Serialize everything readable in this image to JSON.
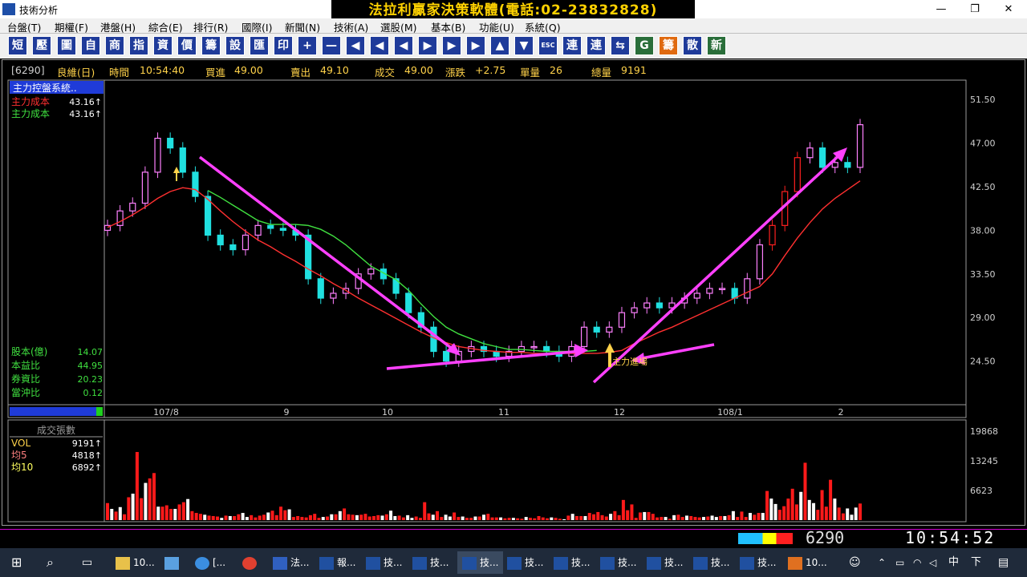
{
  "window": {
    "title": "技術分析",
    "banner": "法拉利贏家決策軟體(電話:02-23832828)",
    "controls": {
      "minimize": "—",
      "maximize": "❐",
      "close": "✕"
    }
  },
  "menu": [
    "台盤(T)",
    "期權(F)",
    "港盤(H)",
    "綜合(E)",
    "排行(R)",
    "國際(I)",
    "新聞(N)",
    "技術(A)",
    "選股(M)",
    "基本(B)",
    "功能(U)",
    "系統(Q)"
  ],
  "toolbar": [
    "短",
    "壓",
    "圖",
    "自",
    "商",
    "指",
    "資",
    "價",
    "籌",
    "設",
    "匯",
    "印",
    "+",
    "—",
    "◀",
    "◀",
    "◀",
    "▶",
    "▶",
    "▶",
    "▲",
    "▼",
    "ESC",
    "連",
    "連",
    "⇆",
    "G",
    "籌",
    "散",
    "新"
  ],
  "info": {
    "code": "[6290]",
    "name": "良維(日)",
    "time_label": "時間",
    "time_value": "10:54:40",
    "bid_label": "買進",
    "bid_value": "49.00",
    "ask_label": "賣出",
    "ask_value": "49.10",
    "deal_label": "成交",
    "deal_value": "49.00",
    "change_label": "漲跌",
    "change_value": "+2.75",
    "vol_label": "單量",
    "vol_value": "26",
    "total_label": "總量",
    "total_value": "9191"
  },
  "indicator": {
    "header": "主力控盤系統..",
    "lines": [
      {
        "label": "主力成本",
        "value": "43.16↑",
        "color": "#ff3030"
      },
      {
        "label": "主力成本",
        "value": "43.16↑",
        "color": "#40e040"
      }
    ]
  },
  "fundamentals": [
    {
      "label": "股本(億)",
      "value": "14.07"
    },
    {
      "label": "本益比",
      "value": "44.95"
    },
    {
      "label": "券資比",
      "value": "20.23"
    },
    {
      "label": "當沖比",
      "value": "0.12"
    }
  ],
  "volume_panel": {
    "header": "成交張數",
    "lines": [
      {
        "label": "VOL",
        "value": "9191↑",
        "color": "#ffd24a"
      },
      {
        "label": "均5",
        "value": "4818↑",
        "color": "#ff8080"
      },
      {
        "label": "均10",
        "value": "6892↑",
        "color": "#ffff60"
      }
    ]
  },
  "annotation": "主力進場",
  "status": {
    "code": "6290",
    "clock": "10:54:52"
  },
  "taskbar": [
    "10...",
    "[...",
    "法...",
    "報...",
    "技...",
    "技...",
    "技...",
    "技...",
    "技...",
    "技...",
    "技...",
    "技...",
    "技...",
    "10..."
  ],
  "tray": {
    "ime": "中",
    "clock": "下"
  },
  "chart_data": [
    {
      "type": "candlestick",
      "title": "",
      "x_ticks": [
        "107/8",
        "9",
        "10",
        "11",
        "12",
        "108/1",
        "2"
      ],
      "ylim": [
        20.0,
        53.5
      ],
      "y_ticks": [
        "51.50",
        "47.00",
        "42.50",
        "38.00",
        "33.50",
        "29.00",
        "24.50"
      ],
      "grid": false,
      "series": [
        {
          "name": "主力成本",
          "color": "#ff3030",
          "type": "line",
          "values": [
            38.3,
            38.9,
            39.6,
            40.4,
            41.3,
            42.0,
            42.4,
            42.2,
            41.2,
            40.0,
            38.9,
            37.9,
            37.0,
            36.3,
            35.5,
            34.8,
            34.0,
            33.3,
            32.5,
            31.8,
            31.0,
            30.3,
            29.6,
            28.9,
            28.2,
            27.5,
            26.9,
            26.4,
            26.0,
            25.8,
            25.6,
            25.5,
            25.4,
            25.4,
            25.3,
            25.3,
            25.3,
            25.3,
            25.3,
            25.3,
            25.4,
            25.6,
            26.3,
            26.9,
            27.5,
            28.0,
            28.6,
            29.2,
            29.8,
            30.4,
            31.0,
            31.6,
            32.2,
            33.5,
            35.4,
            37.2,
            38.8,
            40.2,
            41.3,
            42.2,
            43.1
          ]
        },
        {
          "name": "主力成本",
          "color": "#40e040",
          "type": "line",
          "values": [
            null,
            null,
            null,
            null,
            null,
            null,
            null,
            null,
            42.1,
            41.4,
            40.6,
            39.8,
            39.0,
            38.6,
            38.6,
            38.6,
            38.5,
            38.1,
            37.4,
            36.5,
            35.4,
            34.3,
            33.6,
            32.9,
            31.8,
            30.4,
            29.1,
            28.0,
            27.3,
            26.8,
            26.3,
            26.0,
            25.7,
            25.7,
            25.6,
            25.5,
            25.5,
            25.5,
            25.5,
            25.6,
            null,
            null,
            null,
            null,
            null,
            null,
            null,
            null,
            null,
            null,
            null,
            null,
            null,
            null,
            null,
            null,
            null,
            null,
            null,
            null,
            null
          ]
        }
      ],
      "candles_close": [
        38.5,
        40.0,
        40.8,
        44.0,
        47.5,
        46.5,
        44.0,
        41.5,
        37.5,
        36.5,
        36.0,
        37.5,
        38.5,
        38.2,
        38.0,
        37.5,
        33.0,
        31.0,
        31.5,
        32.0,
        33.5,
        34.0,
        33.0,
        31.5,
        29.5,
        28.0,
        25.5,
        24.5,
        25.5,
        26.0,
        25.5,
        25.0,
        25.5,
        26.0,
        26.0,
        25.5,
        25.0,
        26.0,
        28.0,
        27.5,
        28.0,
        29.5,
        30.0,
        30.5,
        30.0,
        30.5,
        31.0,
        31.5,
        32.0,
        32.0,
        31.0,
        33.0,
        36.5,
        38.5,
        42.0,
        45.5,
        46.5,
        44.5,
        45.0,
        44.5,
        48.9
      ],
      "volumes": [
        3800,
        2500,
        1900,
        2900,
        1300,
        5100,
        5900,
        15200,
        4900,
        8300,
        9300,
        10500,
        3000,
        3000,
        3300,
        2500,
        2500,
        3500,
        4000,
        4700,
        2000,
        1600,
        1400,
        1200,
        1000,
        900,
        800,
        500,
        1000,
        900,
        900,
        1300,
        1600,
        700,
        1100,
        600,
        1000,
        1200,
        1700,
        2100,
        1100,
        3000,
        2200,
        2400,
        700,
        900,
        700,
        600,
        1100,
        1400,
        500,
        700,
        800,
        1300,
        1300,
        2000,
        2600,
        1300,
        1200,
        1100,
        1200,
        1400,
        800,
        900,
        1100,
        1000,
        1300,
        2100,
        900,
        1000,
        600,
        1100,
        500,
        800,
        500,
        4000,
        1500,
        1200,
        2000,
        700,
        1200,
        800,
        1700,
        700,
        800,
        500,
        500,
        800,
        800,
        1200,
        1400,
        600,
        600,
        600,
        400,
        500,
        500,
        400,
        300,
        700,
        500,
        400,
        900,
        600,
        400,
        600,
        500,
        300,
        200,
        1000,
        1400,
        900,
        900,
        900,
        1600,
        1300,
        1800,
        1100,
        800,
        1400,
        2000,
        1100,
        4500,
        2200,
        3500,
        500,
        1700,
        1800,
        1800,
        1400,
        600,
        700,
        700,
        300,
        1100,
        1200,
        700,
        1000,
        900,
        700,
        600,
        700,
        800,
        1000,
        700,
        900,
        900,
        1100,
        2000,
        700,
        1900,
        700,
        1600,
        1200,
        1600,
        1600,
        6500,
        4800,
        3600,
        2300,
        3100,
        4800,
        7000,
        3500,
        6300,
        12800,
        4500,
        3800,
        2300,
        6700,
        3000,
        9000,
        4800,
        2800,
        1500,
        2600,
        1200,
        2800,
        3700
      ]
    }
  ]
}
